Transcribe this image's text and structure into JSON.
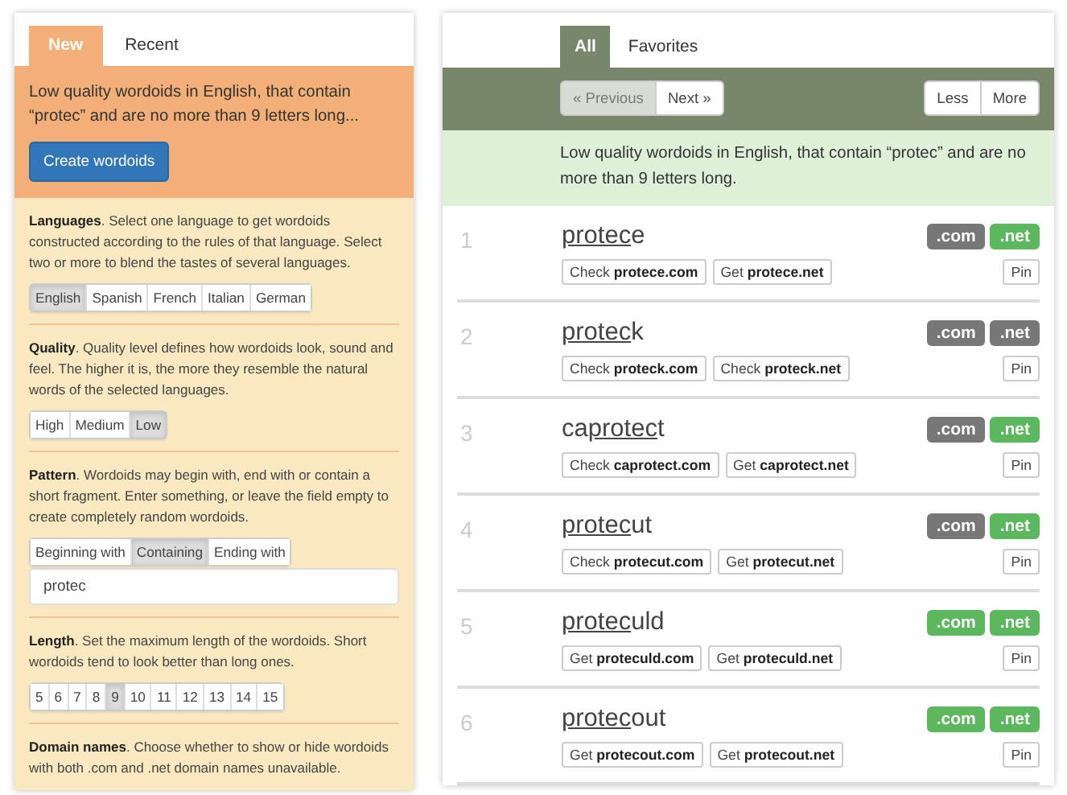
{
  "left_tabs": [
    {
      "label": "New",
      "selected": true
    },
    {
      "label": "Recent",
      "selected": false
    }
  ],
  "summary": "Low quality wordoids in English, that contain “protec” and are no more than 9 letters long...",
  "create_button": "Create wordoids",
  "sections": [
    {
      "text": "**Languages**. Select one language to get wordoids constructed according to the rules of that language. Select two or more to blend the tastes of several languages.",
      "options": [
        {
          "label": "English",
          "selected": true
        },
        {
          "label": "Spanish",
          "selected": false
        },
        {
          "label": "French",
          "selected": false
        },
        {
          "label": "Italian",
          "selected": false
        },
        {
          "label": "German",
          "selected": false
        }
      ]
    },
    {
      "text": "**Quality**. Quality level defines how wordoids look, sound and feel. The higher it is, the more they resemble the natural words of the selected languages.",
      "options": [
        {
          "label": "High",
          "selected": false
        },
        {
          "label": "Medium",
          "selected": false
        },
        {
          "label": "Low",
          "selected": true
        }
      ]
    },
    {
      "text": "**Pattern**. Wordoids may begin with, end with or contain a short fragment. Enter something, or leave the field empty to create completely random wordoids.",
      "options": [
        {
          "label": "Beginning with",
          "selected": false
        },
        {
          "label": "Containing",
          "selected": true
        },
        {
          "label": "Ending with",
          "selected": false
        }
      ],
      "input": {
        "value": "protec"
      }
    },
    {
      "text": "**Length**. Set the maximum length of the wordoids. Short wordoids tend to look better than long ones.",
      "options": [
        {
          "label": "5",
          "selected": false
        },
        {
          "label": "6",
          "selected": false
        },
        {
          "label": "7",
          "selected": false
        },
        {
          "label": "8",
          "selected": false
        },
        {
          "label": "9",
          "selected": true
        },
        {
          "label": "10",
          "selected": false
        },
        {
          "label": "11",
          "selected": false
        },
        {
          "label": "12",
          "selected": false
        },
        {
          "label": "13",
          "selected": false
        },
        {
          "label": "14",
          "selected": false
        },
        {
          "label": "15",
          "selected": false
        }
      ]
    },
    {
      "text": "**Domain names**. Choose whether to show or hide wordoids with both .com and .net domain names unavailable."
    }
  ],
  "right_tabs": [
    {
      "label": "All",
      "selected": true
    },
    {
      "label": "Favorites",
      "selected": false
    }
  ],
  "pager": [
    {
      "label": "« Previous",
      "disabled": true
    },
    {
      "label": "Next »",
      "disabled": false
    }
  ],
  "size_buttons": [
    "Less",
    "More"
  ],
  "description": "Low quality wordoids in English, that contain “protec” and are no more than 9 letters long.",
  "results": [
    {
      "number": "1",
      "word": {
        "match": "protec",
        "after": "e"
      },
      "domains": [
        {
          "label": ".com",
          "available": false
        },
        {
          "label": ".net",
          "available": true
        }
      ],
      "actions": [
        "Check **protece.com**",
        "Get **protece.net**"
      ],
      "pin": "Pin"
    },
    {
      "number": "2",
      "word": {
        "match": "protec",
        "after": "k"
      },
      "domains": [
        {
          "label": ".com",
          "available": false
        },
        {
          "label": ".net",
          "available": false
        }
      ],
      "actions": [
        "Check **proteck.com**",
        "Check **proteck.net**"
      ],
      "pin": "Pin"
    },
    {
      "number": "3",
      "word": {
        "before": "ca",
        "match": "protec",
        "after": "t"
      },
      "domains": [
        {
          "label": ".com",
          "available": false
        },
        {
          "label": ".net",
          "available": true
        }
      ],
      "actions": [
        "Check **caprotect.com**",
        "Get **caprotect.net**"
      ],
      "pin": "Pin"
    },
    {
      "number": "4",
      "word": {
        "match": "protec",
        "after": "ut"
      },
      "domains": [
        {
          "label": ".com",
          "available": false
        },
        {
          "label": ".net",
          "available": true
        }
      ],
      "actions": [
        "Check **protecut.com**",
        "Get **protecut.net**"
      ],
      "pin": "Pin"
    },
    {
      "number": "5",
      "word": {
        "match": "protec",
        "after": "uld"
      },
      "domains": [
        {
          "label": ".com",
          "available": true
        },
        {
          "label": ".net",
          "available": true
        }
      ],
      "actions": [
        "Get **proteculd.com**",
        "Get **proteculd.net**"
      ],
      "pin": "Pin"
    },
    {
      "number": "6",
      "word": {
        "match": "protec",
        "after": "out"
      },
      "domains": [
        {
          "label": ".com",
          "available": true
        },
        {
          "label": ".net",
          "available": true
        }
      ],
      "actions": [
        "Get **protecout.com**",
        "Get **protecout.net**"
      ],
      "pin": "Pin"
    }
  ]
}
